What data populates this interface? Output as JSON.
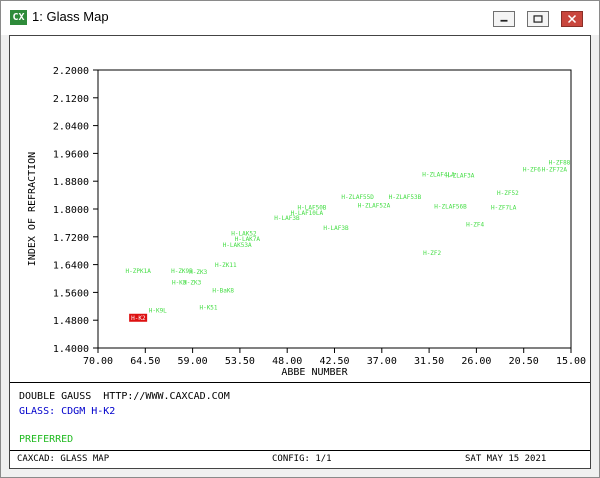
{
  "window": {
    "title": "1: Glass Map",
    "icon_text": "CX",
    "icons": [
      "minimize-icon",
      "maximize-icon",
      "close-icon"
    ]
  },
  "info": {
    "line1": "DOUBLE GAUSS  HTTP://WWW.CAXCAD.COM",
    "line2": "GLASS: CDGM H-K2",
    "line3": "PREFERRED"
  },
  "footer": {
    "left": "CAXCAD: GLASS MAP",
    "center": "CONFIG: 1/1",
    "right": "SAT MAY 15 2021"
  },
  "colors": {
    "glass_label": "#44dd44",
    "selected": "#dd1111",
    "info_blue": "#0000cc",
    "info_green": "#22bb22"
  },
  "chart_data": {
    "type": "scatter",
    "xlabel": "ABBE NUMBER",
    "ylabel": "INDEX OF REFRACTION",
    "xlim": [
      70.0,
      15.0
    ],
    "ylim": [
      1.4,
      2.2
    ],
    "x_ticks": [
      "70.00",
      "64.50",
      "59.00",
      "53.50",
      "48.00",
      "42.50",
      "37.00",
      "31.50",
      "26.00",
      "20.50",
      "15.00"
    ],
    "y_ticks": [
      "2.2000",
      "2.1200",
      "2.0400",
      "1.9600",
      "1.8800",
      "1.8000",
      "1.7200",
      "1.6400",
      "1.5600",
      "1.4800",
      "1.4000"
    ],
    "points": [
      {
        "label": "H-ZF88",
        "x": 17.6,
        "y": 1.934
      },
      {
        "label": "H-ZF6",
        "x": 20.6,
        "y": 1.913
      },
      {
        "label": "H-ZF72A",
        "x": 18.4,
        "y": 1.913
      },
      {
        "label": "H-ZLAF4LA",
        "x": 32.3,
        "y": 1.9
      },
      {
        "label": "H-ZLAF3A",
        "x": 29.6,
        "y": 1.897
      },
      {
        "label": "H-ZF52",
        "x": 23.6,
        "y": 1.846
      },
      {
        "label": "H-ZLAF55D",
        "x": 41.7,
        "y": 1.835
      },
      {
        "label": "H-ZLAF53B",
        "x": 36.2,
        "y": 1.834
      },
      {
        "label": "H-ZLAF52A",
        "x": 39.8,
        "y": 1.81
      },
      {
        "label": "H-ZLAF56B",
        "x": 30.9,
        "y": 1.807
      },
      {
        "label": "H-ZF7LA",
        "x": 24.3,
        "y": 1.805
      },
      {
        "label": "H-LAF50B",
        "x": 46.8,
        "y": 1.804
      },
      {
        "label": "H-LAF10LA",
        "x": 47.6,
        "y": 1.788
      },
      {
        "label": "H-LAF3B",
        "x": 49.5,
        "y": 1.774
      },
      {
        "label": "H-LAF3B",
        "x": 43.8,
        "y": 1.746
      },
      {
        "label": "H-ZF4",
        "x": 27.2,
        "y": 1.755
      },
      {
        "label": "H-LAK52",
        "x": 54.5,
        "y": 1.729
      },
      {
        "label": "H-LAK7A",
        "x": 54.1,
        "y": 1.713
      },
      {
        "label": "H-LAK53A",
        "x": 55.5,
        "y": 1.697
      },
      {
        "label": "H-ZF2",
        "x": 32.2,
        "y": 1.673
      },
      {
        "label": "H-ZK11",
        "x": 56.4,
        "y": 1.639
      },
      {
        "label": "H-ZPK1A",
        "x": 66.8,
        "y": 1.621
      },
      {
        "label": "H-ZK9B",
        "x": 61.5,
        "y": 1.621
      },
      {
        "label": "H-ZK3",
        "x": 59.4,
        "y": 1.618
      },
      {
        "label": "H-K3",
        "x": 61.4,
        "y": 1.588
      },
      {
        "label": "H-ZK3",
        "x": 60.1,
        "y": 1.588
      },
      {
        "label": "H-BaK8",
        "x": 56.7,
        "y": 1.566
      },
      {
        "label": "H-K51",
        "x": 58.2,
        "y": 1.517
      },
      {
        "label": "H-K9L",
        "x": 64.1,
        "y": 1.508
      }
    ],
    "selected": {
      "label": "H-K2",
      "x": 65.1,
      "y": 1.487
    }
  }
}
